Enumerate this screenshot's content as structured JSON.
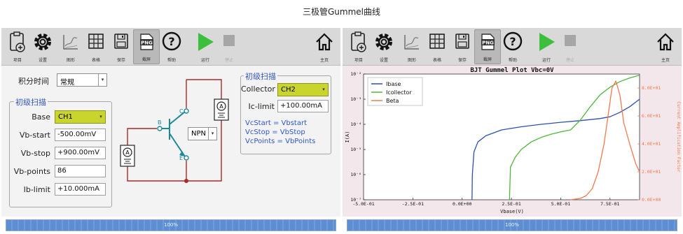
{
  "page_title": "三极管Gummel曲线",
  "toolbar": {
    "project": "项目",
    "settings": "设置",
    "graph": "图形",
    "table": "表格",
    "save": "保存",
    "screenshot": "截屏",
    "help": "帮助",
    "run": "运行",
    "stop": "停止",
    "home": "主页",
    "png_badge": "PNG"
  },
  "left": {
    "integration_label": "积分时间",
    "integration_value": "常规",
    "primary_sweep_title": "初级扫描",
    "base_label": "Base",
    "base_value": "CH1",
    "vb_start_label": "Vb-start",
    "vb_start_value": "-500.00mV",
    "vb_stop_label": "Vb-stop",
    "vb_stop_value": "+900.00mV",
    "vb_points_label": "Vb-points",
    "vb_points_value": "86",
    "ib_limit_label": "Ib-limit",
    "ib_limit_value": "+10.000mA",
    "circuit": {
      "b_label": "B",
      "c_label": "C",
      "e_label": "E",
      "type_value": "NPN",
      "meter_a": "A"
    },
    "secondary_sweep_title": "初级扫描",
    "collector_label": "Collector",
    "collector_value": "CH2",
    "ic_limit_label": "Ic-limit",
    "ic_limit_value": "+100.00mA",
    "formula1": "VcStart = Vbstart",
    "formula2": "VcStop = VbStop",
    "formula3": "VcPoints = VbPoints",
    "progress": "100%"
  },
  "right": {
    "progress": "100%"
  },
  "chart_data": {
    "type": "line",
    "title": "BJT Gummel Plot Vbc=0V",
    "xlabel": "Vbase(V)",
    "ylabel": "I(A)",
    "y2label": "Current Amplification Factor",
    "xlim": [
      -0.5,
      0.9
    ],
    "ylim_log": [
      1e-07,
      0.01
    ],
    "y2lim": [
      0,
      90
    ],
    "y_scale": "log",
    "x_ticks": [
      "-5.0E-01",
      "-2.5E-01",
      "0.0E+00",
      "2.5E-01",
      "5.0E-01",
      "7.5E-01"
    ],
    "y_ticks": [
      "10⁻⁷",
      "10⁻⁶",
      "10⁻⁵",
      "10⁻⁴",
      "10⁻³",
      "10⁻²"
    ],
    "y2_ticks": [
      "0.0E+00",
      "2.0E+01",
      "4.0E+01",
      "6.0E+01",
      "8.0E+01"
    ],
    "legend_position": "top-left",
    "colors": {
      "ibase": "#2b4fb4",
      "icollector": "#4db93a",
      "beta": "#f07a4a"
    },
    "series": [
      {
        "name": "Ibase",
        "axis": "left",
        "x": [
          0.05,
          0.052,
          0.06,
          0.08,
          0.12,
          0.2,
          0.3,
          0.4,
          0.5,
          0.6,
          0.7,
          0.75,
          0.8,
          0.85,
          0.9
        ],
        "y": [
          1e-07,
          1e-06,
          8e-06,
          2e-05,
          3.5e-05,
          6e-05,
          8e-05,
          0.0001,
          0.00012,
          0.00014,
          0.00017,
          0.0002,
          0.0003,
          0.0005,
          0.001
        ]
      },
      {
        "name": "Icollector",
        "axis": "left",
        "x": [
          0.24,
          0.245,
          0.27,
          0.3,
          0.35,
          0.4,
          0.45,
          0.5,
          0.55,
          0.6,
          0.65,
          0.7,
          0.75,
          0.8,
          0.85,
          0.9
        ],
        "y": [
          1e-07,
          2e-06,
          5e-06,
          1e-05,
          2e-05,
          3e-05,
          4e-05,
          5e-05,
          6e-05,
          0.00015,
          0.0005,
          0.0015,
          0.003,
          0.005,
          0.007,
          0.009
        ]
      },
      {
        "name": "Beta",
        "axis": "right",
        "x": [
          0.55,
          0.6,
          0.63,
          0.66,
          0.69,
          0.72,
          0.74,
          0.76,
          0.78,
          0.8,
          0.82,
          0.85,
          0.88,
          0.9
        ],
        "y": [
          0,
          1,
          3,
          8,
          20,
          40,
          60,
          80,
          85,
          75,
          55,
          40,
          26,
          20
        ]
      }
    ]
  }
}
